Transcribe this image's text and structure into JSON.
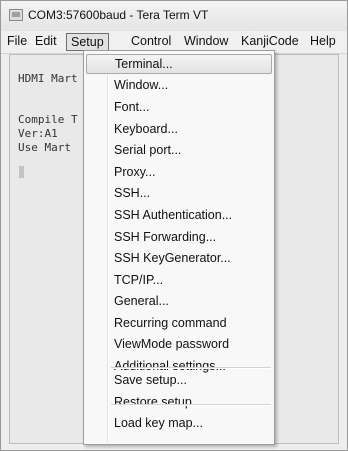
{
  "window": {
    "title": "COM3:57600baud - Tera Term VT"
  },
  "menubar": [
    {
      "id": "file",
      "label": "File",
      "active": false
    },
    {
      "id": "edit",
      "label": "Edit",
      "active": false
    },
    {
      "id": "setup",
      "label": "Setup",
      "active": true
    },
    {
      "id": "control",
      "label": "Control",
      "active": false
    },
    {
      "id": "window",
      "label": "Window",
      "active": false
    },
    {
      "id": "kanjicode",
      "label": "KanjiCode",
      "active": false
    },
    {
      "id": "help",
      "label": "Help",
      "active": false
    }
  ],
  "terminal": {
    "lines": [
      "HDMI Mart",
      "Compile T",
      "Ver:A1",
      "Use Mart"
    ]
  },
  "setup_menu": {
    "items": [
      {
        "id": "terminal",
        "label": "Terminal...",
        "highlighted": true
      },
      {
        "id": "window",
        "label": "Window..."
      },
      {
        "id": "font",
        "label": "Font..."
      },
      {
        "id": "keyboard",
        "label": "Keyboard..."
      },
      {
        "id": "serial-port",
        "label": "Serial port..."
      },
      {
        "id": "proxy",
        "label": "Proxy..."
      },
      {
        "id": "ssh",
        "label": "SSH..."
      },
      {
        "id": "ssh-authentication",
        "label": "SSH Authentication..."
      },
      {
        "id": "ssh-forwarding",
        "label": "SSH Forwarding..."
      },
      {
        "id": "ssh-keygenerator",
        "label": "SSH KeyGenerator..."
      },
      {
        "id": "tcpip",
        "label": "TCP/IP..."
      },
      {
        "id": "general",
        "label": "General..."
      },
      {
        "id": "recurring-command",
        "label": "Recurring command"
      },
      {
        "id": "viewmode-password",
        "label": "ViewMode password"
      },
      {
        "id": "additional-settings",
        "label": "Additional settings..."
      },
      {
        "id": "save-setup",
        "label": "Save setup..."
      },
      {
        "id": "restore-setup",
        "label": "Restore setup..."
      },
      {
        "id": "load-key-map",
        "label": "Load key map..."
      }
    ]
  }
}
